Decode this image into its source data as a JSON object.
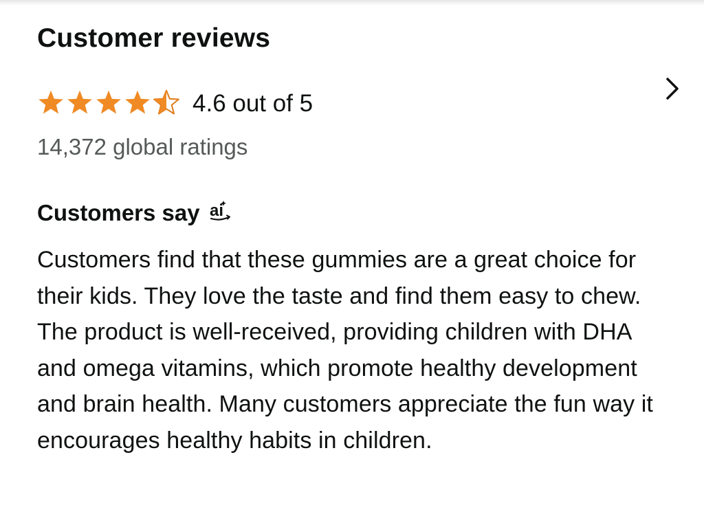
{
  "reviews": {
    "title": "Customer reviews",
    "rating": 4.6,
    "stars_filled_fraction": 0.92,
    "rating_text": "4.6 out of 5",
    "ratings_count": "14,372 global ratings",
    "star_color": "#f08a24",
    "chevron_icon": "chevron-right-icon"
  },
  "customers_say": {
    "heading": "Customers say",
    "badge_icon": "ai-badge-icon",
    "badge_text": "ai",
    "summary": "Customers find that these gummies are a great choice for their kids. They love the taste and find them easy to chew. The product is well-received, providing children with DHA and omega vitamins, which promote healthy development and brain health. Many customers appreciate the fun way it encourages healthy habits in children."
  }
}
